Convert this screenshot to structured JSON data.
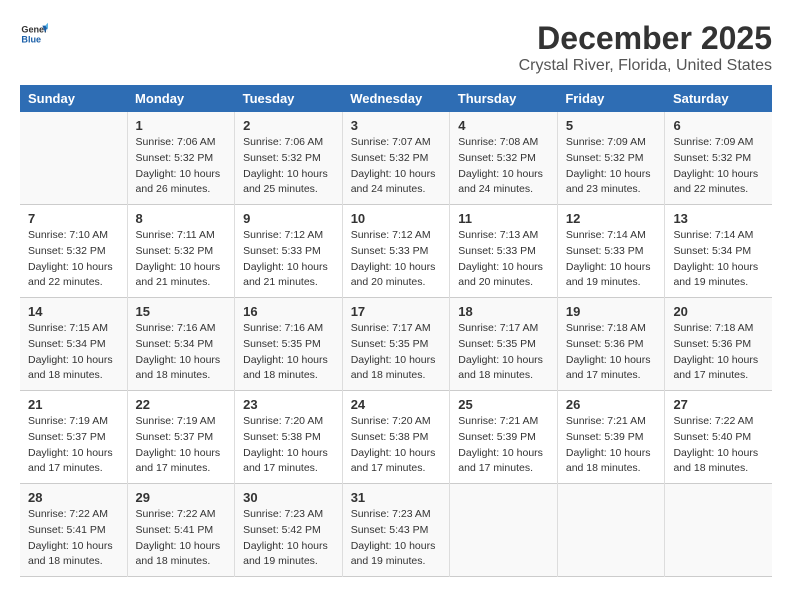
{
  "header": {
    "logo_general": "General",
    "logo_blue": "Blue",
    "title": "December 2025",
    "subtitle": "Crystal River, Florida, United States"
  },
  "calendar": {
    "weekdays": [
      "Sunday",
      "Monday",
      "Tuesday",
      "Wednesday",
      "Thursday",
      "Friday",
      "Saturday"
    ],
    "rows": [
      [
        {
          "day": "",
          "info": ""
        },
        {
          "day": "1",
          "info": "Sunrise: 7:06 AM\nSunset: 5:32 PM\nDaylight: 10 hours\nand 26 minutes."
        },
        {
          "day": "2",
          "info": "Sunrise: 7:06 AM\nSunset: 5:32 PM\nDaylight: 10 hours\nand 25 minutes."
        },
        {
          "day": "3",
          "info": "Sunrise: 7:07 AM\nSunset: 5:32 PM\nDaylight: 10 hours\nand 24 minutes."
        },
        {
          "day": "4",
          "info": "Sunrise: 7:08 AM\nSunset: 5:32 PM\nDaylight: 10 hours\nand 24 minutes."
        },
        {
          "day": "5",
          "info": "Sunrise: 7:09 AM\nSunset: 5:32 PM\nDaylight: 10 hours\nand 23 minutes."
        },
        {
          "day": "6",
          "info": "Sunrise: 7:09 AM\nSunset: 5:32 PM\nDaylight: 10 hours\nand 22 minutes."
        }
      ],
      [
        {
          "day": "7",
          "info": "Sunrise: 7:10 AM\nSunset: 5:32 PM\nDaylight: 10 hours\nand 22 minutes."
        },
        {
          "day": "8",
          "info": "Sunrise: 7:11 AM\nSunset: 5:32 PM\nDaylight: 10 hours\nand 21 minutes."
        },
        {
          "day": "9",
          "info": "Sunrise: 7:12 AM\nSunset: 5:33 PM\nDaylight: 10 hours\nand 21 minutes."
        },
        {
          "day": "10",
          "info": "Sunrise: 7:12 AM\nSunset: 5:33 PM\nDaylight: 10 hours\nand 20 minutes."
        },
        {
          "day": "11",
          "info": "Sunrise: 7:13 AM\nSunset: 5:33 PM\nDaylight: 10 hours\nand 20 minutes."
        },
        {
          "day": "12",
          "info": "Sunrise: 7:14 AM\nSunset: 5:33 PM\nDaylight: 10 hours\nand 19 minutes."
        },
        {
          "day": "13",
          "info": "Sunrise: 7:14 AM\nSunset: 5:34 PM\nDaylight: 10 hours\nand 19 minutes."
        }
      ],
      [
        {
          "day": "14",
          "info": "Sunrise: 7:15 AM\nSunset: 5:34 PM\nDaylight: 10 hours\nand 18 minutes."
        },
        {
          "day": "15",
          "info": "Sunrise: 7:16 AM\nSunset: 5:34 PM\nDaylight: 10 hours\nand 18 minutes."
        },
        {
          "day": "16",
          "info": "Sunrise: 7:16 AM\nSunset: 5:35 PM\nDaylight: 10 hours\nand 18 minutes."
        },
        {
          "day": "17",
          "info": "Sunrise: 7:17 AM\nSunset: 5:35 PM\nDaylight: 10 hours\nand 18 minutes."
        },
        {
          "day": "18",
          "info": "Sunrise: 7:17 AM\nSunset: 5:35 PM\nDaylight: 10 hours\nand 18 minutes."
        },
        {
          "day": "19",
          "info": "Sunrise: 7:18 AM\nSunset: 5:36 PM\nDaylight: 10 hours\nand 17 minutes."
        },
        {
          "day": "20",
          "info": "Sunrise: 7:18 AM\nSunset: 5:36 PM\nDaylight: 10 hours\nand 17 minutes."
        }
      ],
      [
        {
          "day": "21",
          "info": "Sunrise: 7:19 AM\nSunset: 5:37 PM\nDaylight: 10 hours\nand 17 minutes."
        },
        {
          "day": "22",
          "info": "Sunrise: 7:19 AM\nSunset: 5:37 PM\nDaylight: 10 hours\nand 17 minutes."
        },
        {
          "day": "23",
          "info": "Sunrise: 7:20 AM\nSunset: 5:38 PM\nDaylight: 10 hours\nand 17 minutes."
        },
        {
          "day": "24",
          "info": "Sunrise: 7:20 AM\nSunset: 5:38 PM\nDaylight: 10 hours\nand 17 minutes."
        },
        {
          "day": "25",
          "info": "Sunrise: 7:21 AM\nSunset: 5:39 PM\nDaylight: 10 hours\nand 17 minutes."
        },
        {
          "day": "26",
          "info": "Sunrise: 7:21 AM\nSunset: 5:39 PM\nDaylight: 10 hours\nand 18 minutes."
        },
        {
          "day": "27",
          "info": "Sunrise: 7:22 AM\nSunset: 5:40 PM\nDaylight: 10 hours\nand 18 minutes."
        }
      ],
      [
        {
          "day": "28",
          "info": "Sunrise: 7:22 AM\nSunset: 5:41 PM\nDaylight: 10 hours\nand 18 minutes."
        },
        {
          "day": "29",
          "info": "Sunrise: 7:22 AM\nSunset: 5:41 PM\nDaylight: 10 hours\nand 18 minutes."
        },
        {
          "day": "30",
          "info": "Sunrise: 7:23 AM\nSunset: 5:42 PM\nDaylight: 10 hours\nand 19 minutes."
        },
        {
          "day": "31",
          "info": "Sunrise: 7:23 AM\nSunset: 5:43 PM\nDaylight: 10 hours\nand 19 minutes."
        },
        {
          "day": "",
          "info": ""
        },
        {
          "day": "",
          "info": ""
        },
        {
          "day": "",
          "info": ""
        }
      ]
    ]
  }
}
